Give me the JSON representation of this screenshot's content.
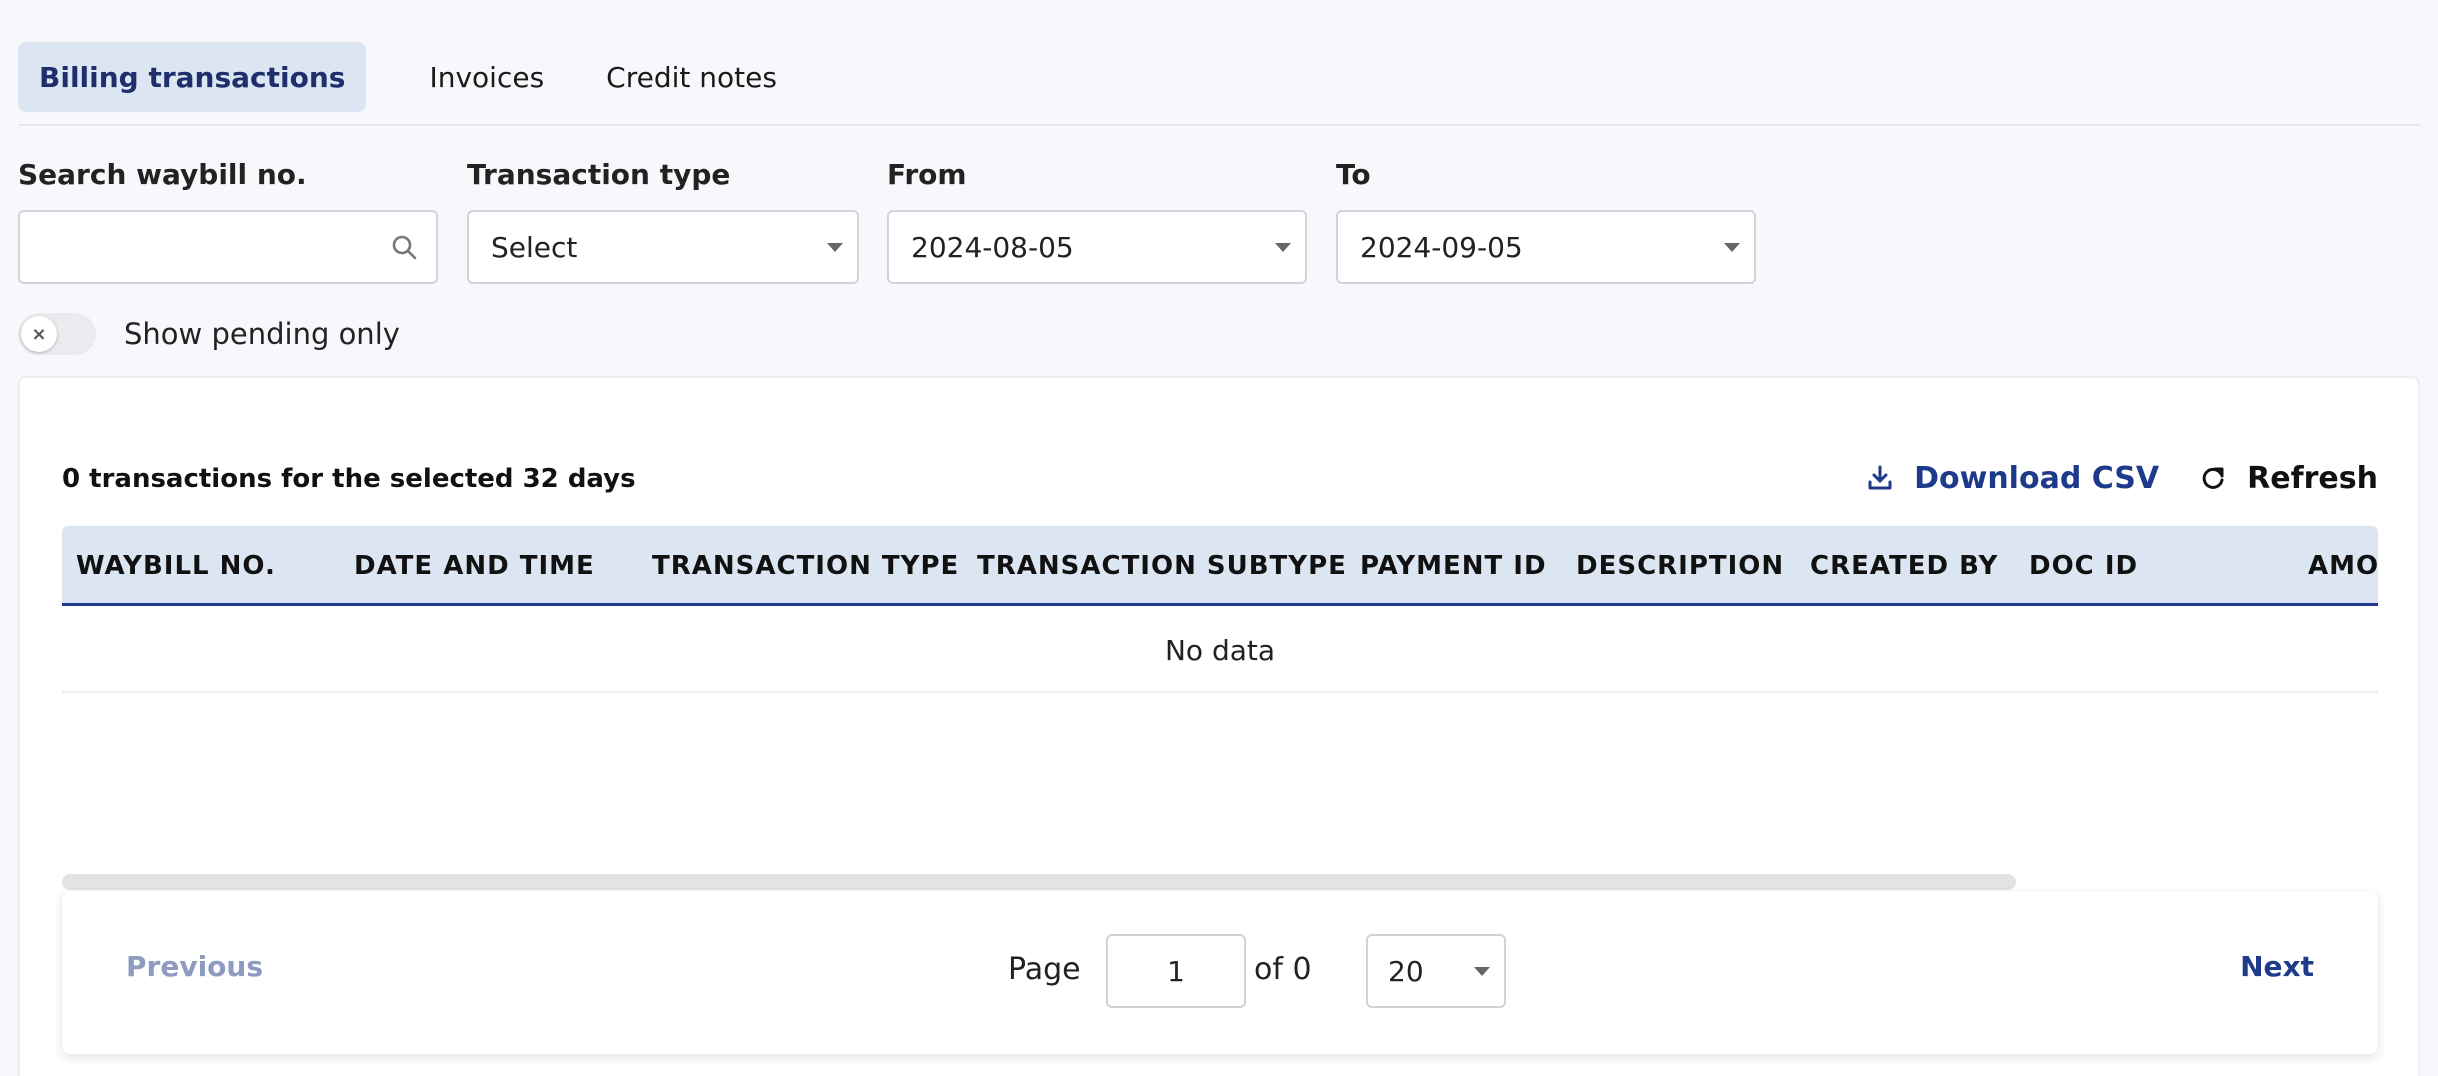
{
  "tabs": [
    {
      "label": "Billing transactions",
      "active": true
    },
    {
      "label": "Invoices",
      "active": false
    },
    {
      "label": "Credit notes",
      "active": false
    }
  ],
  "filters": {
    "search": {
      "label": "Search waybill no.",
      "value": "",
      "placeholder": ""
    },
    "transaction_type": {
      "label": "Transaction type",
      "value": "Select"
    },
    "from": {
      "label": "From",
      "value": "2024-08-05"
    },
    "to": {
      "label": "To",
      "value": "2024-09-05"
    }
  },
  "toggle": {
    "label": "Show pending only",
    "on": false,
    "knob_glyph": "×"
  },
  "summary": {
    "text": "0 transactions for the selected 32 days"
  },
  "actions": {
    "download_csv": "Download CSV",
    "refresh": "Refresh"
  },
  "table": {
    "columns": [
      "WAYBILL NO.",
      "DATE AND TIME",
      "TRANSACTION TYPE",
      "TRANSACTION SUBTYPE",
      "PAYMENT ID",
      "DESCRIPTION",
      "CREATED BY",
      "DOC ID",
      "AMO"
    ],
    "empty_text": "No data"
  },
  "pagination": {
    "previous": "Previous",
    "next": "Next",
    "page_label": "Page",
    "page_value": "1",
    "of_label": "of 0",
    "page_size": "20"
  },
  "colors": {
    "accent": "#1e3a8a",
    "header_bg": "#dce6f3",
    "disabled": "#8e9bc1"
  }
}
